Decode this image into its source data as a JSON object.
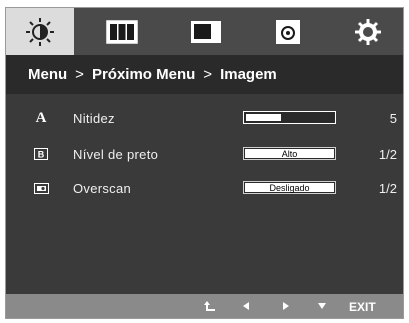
{
  "tabs": [
    {
      "icon": "brightness-icon",
      "active": true
    },
    {
      "icon": "color-bars-icon",
      "active": false
    },
    {
      "icon": "picture-size-icon",
      "active": false
    },
    {
      "icon": "sound-icon",
      "active": false
    },
    {
      "icon": "settings-gear-icon",
      "active": false
    }
  ],
  "breadcrumb": {
    "items": [
      "Menu",
      "Próximo Menu",
      "Imagem"
    ],
    "separator": ">"
  },
  "rows": [
    {
      "icon": "letter-a-icon",
      "icon_text": "A",
      "label": "Nitidez",
      "control": "slider",
      "level": 0.4,
      "value": "5"
    },
    {
      "icon": "black-level-icon",
      "icon_text": "B",
      "label": "Nível de preto",
      "control": "button",
      "control_text": "Alto",
      "value": "1/2"
    },
    {
      "icon": "overscan-icon",
      "icon_text": "",
      "label": "Overscan",
      "control": "button",
      "control_text": "Desligado",
      "value": "1/2"
    }
  ],
  "bottom": {
    "buttons": [
      "back-icon",
      "left-arrow-icon",
      "right-arrow-icon",
      "down-arrow-icon"
    ],
    "exit_label": "EXIT"
  },
  "colors": {
    "panel": "#3a3a3a",
    "header": "#2a2a2a",
    "active_tab": "#dcdcdc",
    "bottom_bar": "#8a8a8a"
  }
}
